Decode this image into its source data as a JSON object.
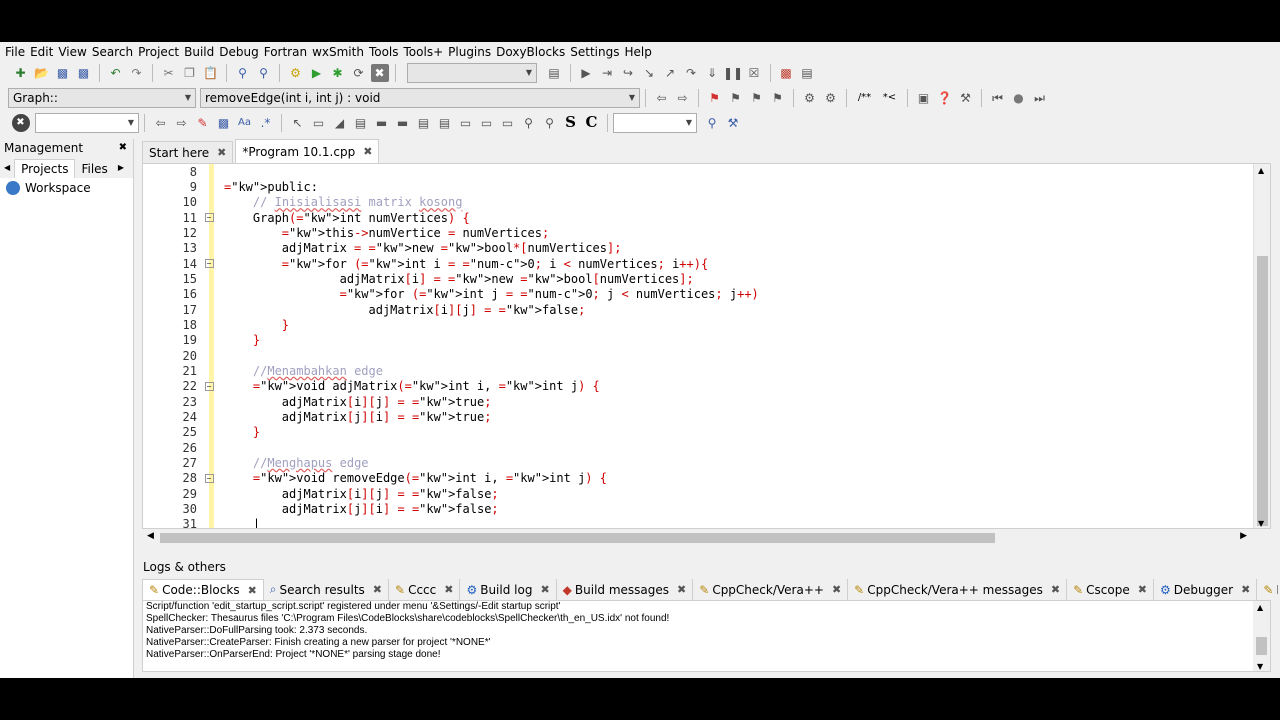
{
  "menu": [
    "File",
    "Edit",
    "View",
    "Search",
    "Project",
    "Build",
    "Debug",
    "Fortran",
    "wxSmith",
    "Tools",
    "Tools+",
    "Plugins",
    "DoxyBlocks",
    "Settings",
    "Help"
  ],
  "scope_combo": "Graph::",
  "function_combo": "removeEdge(int i, int j) : void",
  "management": {
    "title": "Management",
    "tabs": [
      "Projects",
      "Files"
    ],
    "workspace": "Workspace"
  },
  "editor_tabs": [
    {
      "label": "Start here",
      "active": false
    },
    {
      "label": "*Program 10.1.cpp",
      "active": true
    }
  ],
  "code": [
    {
      "n": "8",
      "t": ""
    },
    {
      "n": "9",
      "t": "public:"
    },
    {
      "n": "10",
      "t": "    // Inisialisasi matrix kosong"
    },
    {
      "n": "11",
      "t": "    Graph(int numVertices) {"
    },
    {
      "n": "12",
      "t": "        this->numVertice = numVertices;"
    },
    {
      "n": "13",
      "t": "        adjMatrix = new bool*[numVertices];"
    },
    {
      "n": "14",
      "t": "        for (int i = 0; i < numVertices; i++){"
    },
    {
      "n": "15",
      "t": "                adjMatrix[i] = new bool[numVertices];"
    },
    {
      "n": "16",
      "t": "                for (int j = 0; j < numVertices; j++)"
    },
    {
      "n": "17",
      "t": "                    adjMatrix[i][j] = false;"
    },
    {
      "n": "18",
      "t": "        }"
    },
    {
      "n": "19",
      "t": "    }"
    },
    {
      "n": "20",
      "t": ""
    },
    {
      "n": "21",
      "t": "    //Menambahkan edge"
    },
    {
      "n": "22",
      "t": "    void adjMatrix(int i, int j) {"
    },
    {
      "n": "23",
      "t": "        adjMatrix[i][j] = true;"
    },
    {
      "n": "24",
      "t": "        adjMatrix[j][i] = true;"
    },
    {
      "n": "25",
      "t": "    }"
    },
    {
      "n": "26",
      "t": ""
    },
    {
      "n": "27",
      "t": "    //Menghapus edge"
    },
    {
      "n": "28",
      "t": "    void removeEdge(int i, int j) {"
    },
    {
      "n": "29",
      "t": "        adjMatrix[i][j] = false;"
    },
    {
      "n": "30",
      "t": "        adjMatrix[j][i] = false;"
    },
    {
      "n": "31",
      "t": "    |"
    }
  ],
  "logs": {
    "title": "Logs & others",
    "tabs": [
      {
        "label": "Code::Blocks",
        "icon": "document-icon",
        "active": true
      },
      {
        "label": "Search results",
        "icon": "search-icon",
        "active": false
      },
      {
        "label": "Cccc",
        "icon": "document-icon",
        "active": false
      },
      {
        "label": "Build log",
        "icon": "gear-icon",
        "active": false
      },
      {
        "label": "Build messages",
        "icon": "diamond-icon",
        "active": false
      },
      {
        "label": "CppCheck/Vera++",
        "icon": "document-icon",
        "active": false
      },
      {
        "label": "CppCheck/Vera++ messages",
        "icon": "document-icon",
        "active": false
      },
      {
        "label": "Cscope",
        "icon": "document-icon",
        "active": false
      },
      {
        "label": "Debugger",
        "icon": "gear-icon",
        "active": false
      },
      {
        "label": "D",
        "icon": "document-icon",
        "active": false
      }
    ],
    "lines": [
      "Script/function 'edit_startup_script.script' registered under menu '&Settings/-Edit startup script'",
      "SpellChecker: Thesaurus files 'C:\\Program Files\\CodeBlocks\\share\\codeblocks\\SpellChecker\\th_en_US.idx' not found!",
      "NativeParser::DoFullParsing took: 2.373 seconds.",
      "NativeParser::CreateParser: Finish creating a new parser for project '*NONE*'",
      "NativeParser::OnParserEnd: Project '*NONE*' parsing stage done!"
    ]
  }
}
